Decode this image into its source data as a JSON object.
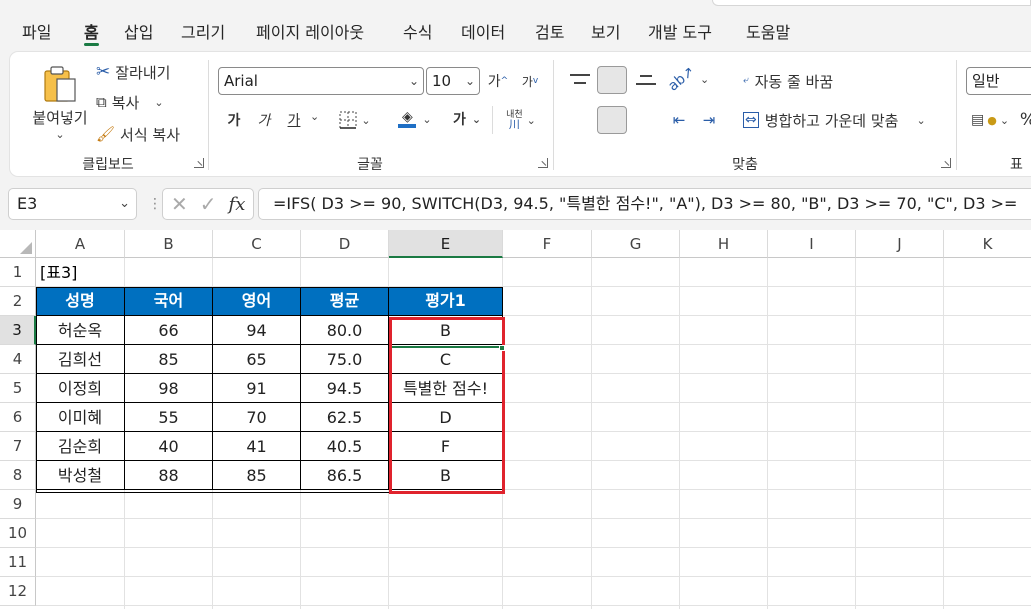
{
  "menu": {
    "tabs": [
      "파일",
      "홈",
      "삽입",
      "그리기",
      "페이지 레이아웃",
      "수식",
      "데이터",
      "검토",
      "보기",
      "개발 도구",
      "도움말"
    ],
    "active": "홈"
  },
  "ribbon": {
    "clipboard": {
      "paste_label": "붙여넣기",
      "cut_label": "잘라내기",
      "copy_label": "복사",
      "format_painter_label": "서식 복사",
      "group_label": "클립보드"
    },
    "font": {
      "font_name": "Arial",
      "font_size": "10",
      "grow_label": "가",
      "shrink_label": "가",
      "bold_label": "가",
      "italic_label": "가",
      "underline_label": "가",
      "color_label": "가",
      "phonetic_label": "내천",
      "group_label": "글꼴"
    },
    "alignment": {
      "wrap_label": "자동 줄 바꿈",
      "merge_label": "병합하고 가운데 맞춤",
      "group_label": "맞춤"
    },
    "number": {
      "format": "일반",
      "group_label": "표"
    }
  },
  "formula_bar": {
    "name_box": "E3",
    "formula": "=IFS( D3 >= 90, SWITCH(D3, 94.5, \"특별한 점수!\", \"A\"), D3 >= 80, \"B\", D3 >= 70, \"C\", D3 >="
  },
  "sheet": {
    "columns": [
      "A",
      "B",
      "C",
      "D",
      "E",
      "F",
      "G",
      "H",
      "I",
      "J",
      "K"
    ],
    "rows": [
      "1",
      "2",
      "3",
      "4",
      "5",
      "6",
      "7",
      "8",
      "9",
      "10",
      "11",
      "12"
    ],
    "selected_column": "E",
    "selected_row": "3",
    "caption": "[표3]",
    "table_headers": [
      "성명",
      "국어",
      "영어",
      "평균",
      "평가1"
    ],
    "table_rows": [
      [
        "허순옥",
        "66",
        "94",
        "80.0",
        "B"
      ],
      [
        "김희선",
        "85",
        "65",
        "75.0",
        "C"
      ],
      [
        "이정희",
        "98",
        "91",
        "94.5",
        "특별한 점수!"
      ],
      [
        "이미혜",
        "55",
        "70",
        "62.5",
        "D"
      ],
      [
        "김순희",
        "40",
        "41",
        "40.5",
        "F"
      ],
      [
        "박성철",
        "88",
        "85",
        "86.5",
        "B"
      ]
    ],
    "colors": {
      "header_bg": "#0070c0",
      "highlight": "#e0232d",
      "accent": "#1a7a43"
    }
  }
}
